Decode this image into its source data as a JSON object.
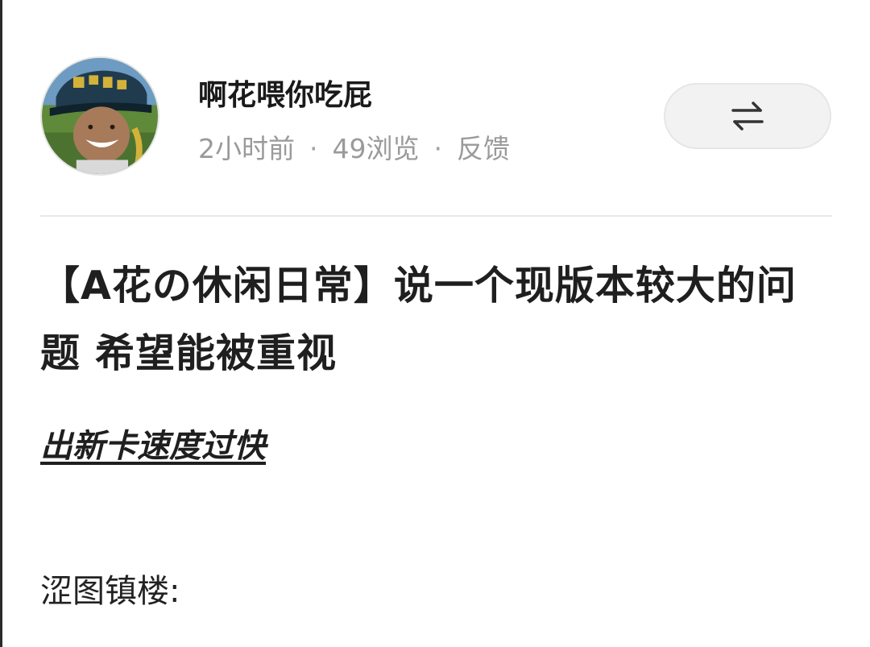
{
  "header": {
    "username": "啊花喂你吃屁",
    "meta": {
      "time": "2小时前",
      "separator": "·",
      "views": "49浏览",
      "feedback": "反馈"
    },
    "switch_icon": "swap-arrows-icon",
    "avatar_icon": "user-avatar"
  },
  "post": {
    "title": "【A花の休闲日常】说一个现版本较大的问题 希望能被重视",
    "subheading": "出新卡速度过快",
    "body_line": "涩图镇楼:"
  },
  "colors": {
    "text_primary": "#1f1f1f",
    "text_secondary": "#9a9a9a",
    "button_bg": "#f2f2f2",
    "divider": "#e8e8e8"
  }
}
